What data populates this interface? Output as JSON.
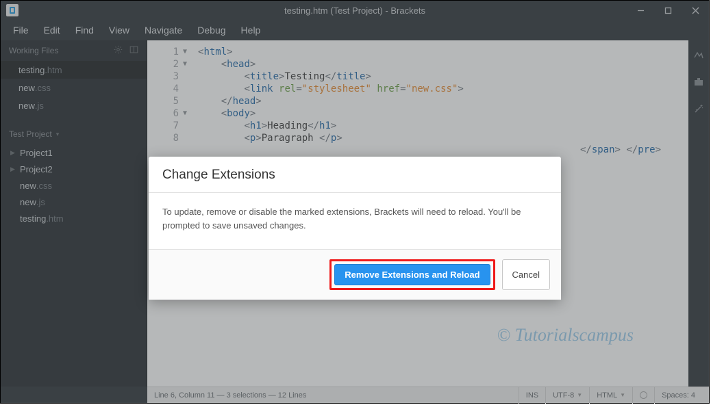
{
  "titlebar": {
    "title": "testing.htm (Test Project) - Brackets"
  },
  "menu": [
    "File",
    "Edit",
    "Find",
    "View",
    "Navigate",
    "Debug",
    "Help"
  ],
  "sidebar": {
    "workingFilesLabel": "Working Files",
    "workingFiles": [
      {
        "name": "testing",
        "ext": ".htm",
        "active": true
      },
      {
        "name": "new",
        "ext": ".css",
        "active": false
      },
      {
        "name": "new",
        "ext": ".js",
        "active": false
      }
    ],
    "projectLabel": "Test Project",
    "tree": [
      {
        "type": "folder",
        "name": "Project1"
      },
      {
        "type": "folder",
        "name": "Project2"
      },
      {
        "type": "file",
        "name": "new",
        "ext": ".css"
      },
      {
        "type": "file",
        "name": "new",
        "ext": ".js"
      },
      {
        "type": "file",
        "name": "testing",
        "ext": ".htm"
      }
    ]
  },
  "editor": {
    "code_visible_fragment_right": "</span> </pre>"
  },
  "statusbar": {
    "left": "Line 6, Column 11 — 3 selections — 12 Lines",
    "ins": "INS",
    "encoding": "UTF-8",
    "lang": "HTML",
    "spaces": "Spaces: 4"
  },
  "dialog": {
    "title": "Change Extensions",
    "body": "To update, remove or disable the marked extensions, Brackets will need to reload. You'll be prompted to save unsaved changes.",
    "primary": "Remove Extensions and Reload",
    "cancel": "Cancel"
  },
  "watermark": "© Tutorialscampus"
}
